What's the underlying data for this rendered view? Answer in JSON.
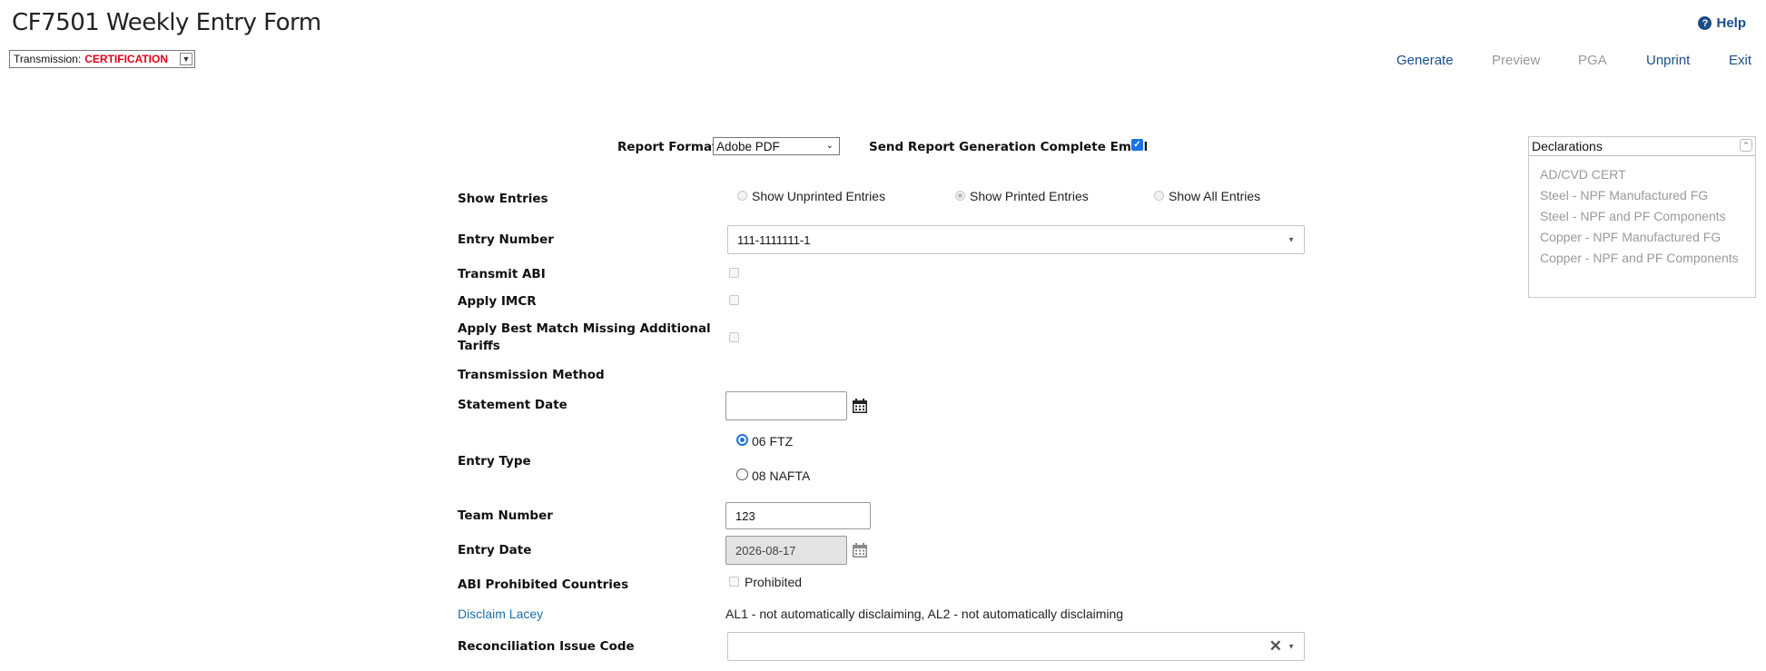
{
  "page": {
    "title": "CF7501 Weekly Entry Form"
  },
  "help": {
    "label": "Help"
  },
  "transmission": {
    "label": "Transmission:",
    "value": "CERTIFICATION"
  },
  "toolbar": {
    "generate": "Generate",
    "preview": "Preview",
    "pga": "PGA",
    "unprint": "Unprint",
    "exit": "Exit"
  },
  "report": {
    "format_label": "Report Format",
    "format_value": "Adobe PDF",
    "email_label": "Send Report Generation Complete Email",
    "email_checked": true
  },
  "show_entries": {
    "label": "Show Entries",
    "options": [
      "Show Unprinted Entries",
      "Show Printed Entries",
      "Show All Entries"
    ],
    "selected": "Show Printed Entries"
  },
  "entry_number": {
    "label": "Entry Number",
    "value": "111-1111111-1"
  },
  "transmit_abi": {
    "label": "Transmit ABI"
  },
  "apply_imcr": {
    "label": "Apply IMCR"
  },
  "apply_best_match": {
    "label_line1": "Apply Best Match Missing Additional",
    "label_line2": "Tariffs"
  },
  "transmission_method": {
    "label": "Transmission Method"
  },
  "statement_date": {
    "label": "Statement Date",
    "value": ""
  },
  "entry_type": {
    "label": "Entry Type",
    "options": [
      "06 FTZ",
      "08 NAFTA"
    ],
    "selected": "06 FTZ"
  },
  "team_number": {
    "label": "Team Number",
    "value": "123"
  },
  "entry_date": {
    "label": "Entry Date",
    "value": "2026-08-17"
  },
  "abi_prohibited": {
    "label": "ABI Prohibited Countries",
    "checkbox_label": "Prohibited"
  },
  "disclaim_lacey": {
    "label": "Disclaim Lacey",
    "value": "AL1 - not automatically disclaiming, AL2 - not automatically disclaiming"
  },
  "reconciliation": {
    "label": "Reconciliation Issue Code",
    "value": ""
  },
  "declarations": {
    "title": "Declarations",
    "items": [
      "AD/CVD CERT",
      "Steel - NPF Manufactured FG",
      "Steel - NPF and PF Components",
      "Copper - NPF Manufactured FG",
      "Copper - NPF and PF Components"
    ]
  },
  "icons": [
    "help-icon",
    "dropdown-arrow-icon",
    "calendar-icon",
    "clear-icon",
    "collapse-icon"
  ],
  "colors": {
    "accent": "#1a4e8a",
    "alert": "#e0001b",
    "link": "#1a6ea8",
    "disabled": "#999999"
  }
}
